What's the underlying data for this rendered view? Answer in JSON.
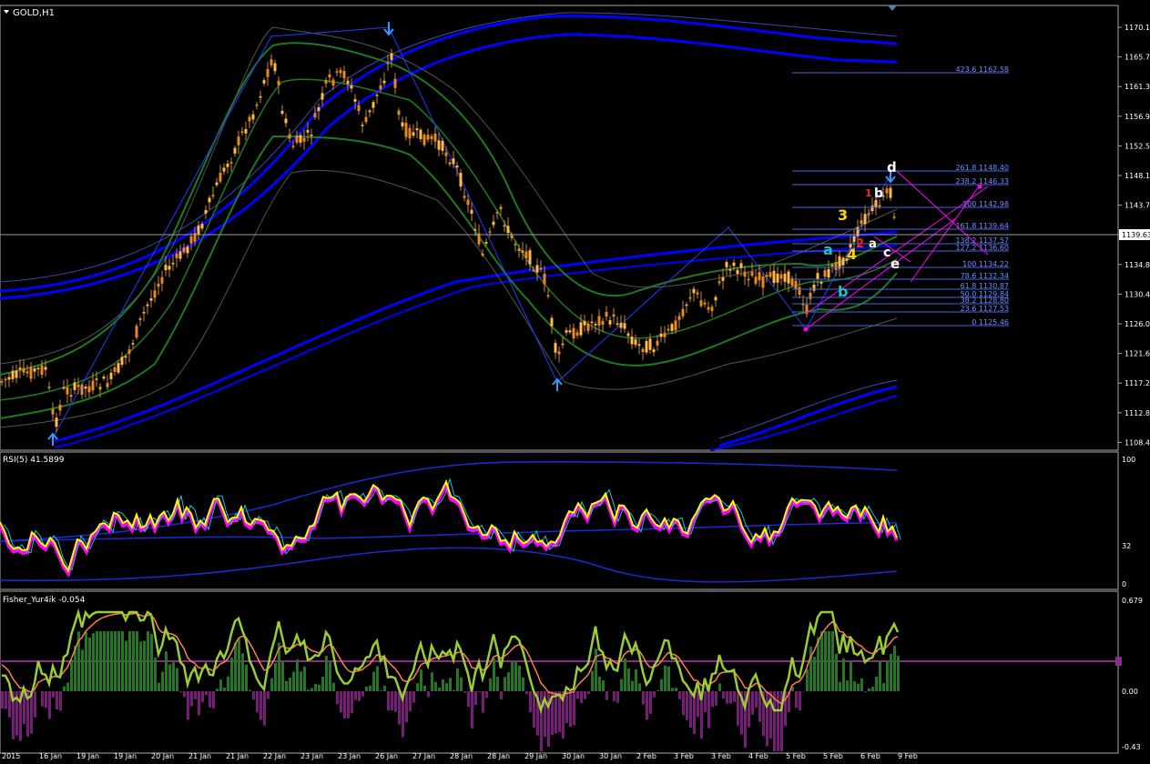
{
  "colors": {
    "background": "#000000",
    "frame": "#a9a9a9",
    "bull_candle": "#ffa500",
    "bear_candle": "#ffb84d",
    "bb_outer": "#0000ff",
    "bb_green": "#1f7a1f",
    "rsi_main": "#ffff00",
    "rsi_shadow": "#ff00ff",
    "fisher_line": "#9acd32",
    "fisher_signal": "#ff7f50",
    "fisher_pos_hist": "#228b22",
    "fisher_neg_hist": "#8b008b",
    "fib_line": "#4169e1",
    "channel": "#ff00ff"
  },
  "main_chart": {
    "title": "GOLD,H1",
    "current_price": "1139.63",
    "price_axis": [
      "1170.10",
      "1165.70",
      "1161.30",
      "1156.90",
      "1152.50",
      "1148.10",
      "1143.70",
      "1139.30",
      "1134.80",
      "1130.40",
      "1126.00",
      "1121.60",
      "1117.20",
      "1112.80",
      "1108.40"
    ],
    "fib_levels": [
      "423.6 1162.58",
      "261.8 1148.40",
      "238.2 1146.33",
      "200 1142.98",
      "161.8 1139.64",
      "138.2 1137.57",
      "127.2 1136.60",
      "100 1134.22",
      "78.6 1132.34",
      "61.8 1130.87",
      "50.0 1129.84",
      "38.2 1128.80",
      "23.6 1127.53",
      "0 1125.46"
    ],
    "wave_labels": [
      "3",
      "4",
      "2",
      "1",
      "a",
      "b",
      "a",
      "b",
      "c",
      "d",
      "e"
    ],
    "arrows": [
      "down",
      "up",
      "up",
      "down",
      "down"
    ]
  },
  "rsi": {
    "title": "RSI(5) 41.5899",
    "axis": [
      "100",
      "32",
      "0"
    ]
  },
  "fisher": {
    "title": "Fisher_Yur4ik -0.054",
    "axis": [
      "0.679",
      "0.00",
      "-0.43"
    ]
  },
  "time_axis": [
    "2015",
    "16 Jan",
    "19 Jan",
    "19 Jan",
    "20 Jan",
    "21 Jan",
    "21 Jan",
    "22 Jan",
    "23 Jan",
    "23 Jan",
    "26 Jan",
    "27 Jan",
    "28 Jan",
    "28 Jan",
    "29 Jan",
    "30 Jan",
    "30 Jan",
    "2 Feb",
    "3 Feb",
    "3 Feb",
    "4 Feb",
    "5 Feb",
    "5 Feb",
    "6 Feb",
    "9 Feb"
  ]
}
